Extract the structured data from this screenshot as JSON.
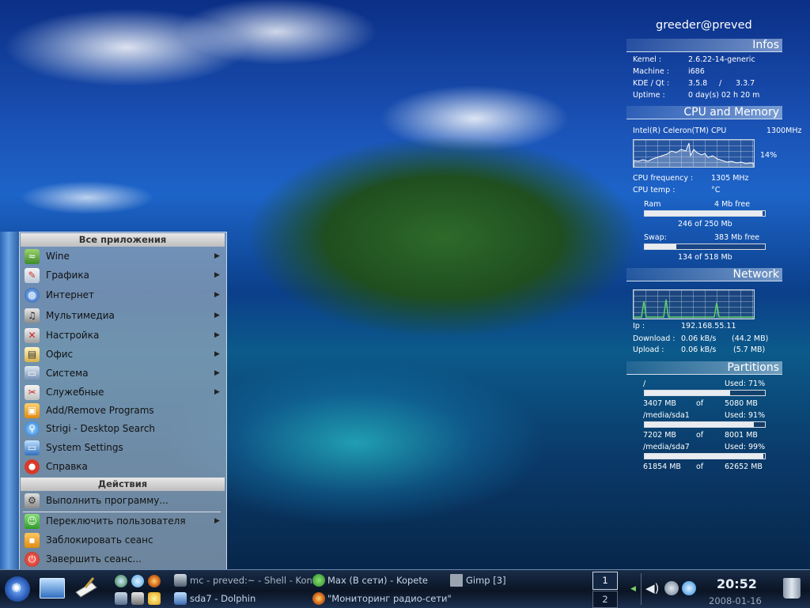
{
  "colors": {
    "accent": "#1d64c8",
    "menu_bg": "#96aabe",
    "taskbar": "#0a1424"
  },
  "menu": {
    "header_all": "Все приложения",
    "header_actions": "Действия",
    "items": [
      {
        "label": "Wine",
        "icon": "wine-icon",
        "arrow": true
      },
      {
        "label": "Графика",
        "icon": "graphics-icon",
        "arrow": true
      },
      {
        "label": "Интернет",
        "icon": "internet-icon",
        "arrow": true
      },
      {
        "label": "Мультимедиа",
        "icon": "multimedia-icon",
        "arrow": true
      },
      {
        "label": "Настройка",
        "icon": "settings-tools-icon",
        "arrow": true
      },
      {
        "label": "Офис",
        "icon": "office-icon",
        "arrow": true
      },
      {
        "label": "Система",
        "icon": "system-icon",
        "arrow": true
      },
      {
        "label": "Служебные",
        "icon": "utilities-icon",
        "arrow": true
      },
      {
        "label": "Add/Remove Programs",
        "icon": "package-icon",
        "arrow": false
      },
      {
        "label": "Strigi - Desktop Search",
        "icon": "search-icon",
        "arrow": false
      },
      {
        "label": "System Settings",
        "icon": "system-settings-icon",
        "arrow": false
      },
      {
        "label": "Справка",
        "icon": "help-icon",
        "arrow": false
      }
    ],
    "actions": [
      {
        "label": "Выполнить программу...",
        "icon": "gear-icon",
        "arrow": false
      },
      {
        "label": "Переключить пользователя",
        "icon": "user-switch-icon",
        "arrow": true
      },
      {
        "label": "Заблокировать сеанс",
        "icon": "lock-icon",
        "arrow": false
      },
      {
        "label": "Завершить сеанс...",
        "icon": "logout-icon",
        "arrow": false
      }
    ],
    "arrow_glyph": "▶"
  },
  "conky": {
    "user": "greeder@preved",
    "infos_title": "Infos",
    "kernel_label": "Kernel :",
    "kernel": "2.6.22-14-generic",
    "machine_label": "Machine :",
    "machine": "i686",
    "kde_label": "KDE / Qt :",
    "kde": "3.5.8",
    "kde_sep": "/",
    "qt": "3.3.7",
    "uptime_label": "Uptime :",
    "uptime": "0 day(s)  02 h 20 m",
    "cpu_title": "CPU and Memory",
    "cpu_name": "Intel(R) Celeron(TM) CPU",
    "cpu_mhz": "1300MHz",
    "cpu_usage": "14%",
    "cpu_freq_label": "CPU frequency :",
    "cpu_freq": "1305 MHz",
    "cpu_temp_label": "CPU temp :",
    "cpu_temp": "°C",
    "ram_label": "Ram",
    "ram_free": "4 Mb free",
    "ram_used": "246 of 250 Mb",
    "ram_frac": 0.98,
    "swap_label": "Swap:",
    "swap_free": "383 Mb free",
    "swap_used": "134 of 518 Mb",
    "swap_frac": 0.26,
    "network_title": "Network",
    "ip_label": "Ip :",
    "ip": "192.168.55.11",
    "down_label": "Download :",
    "down_rate": "0.06 kB/s",
    "down_total": "(44.2 MB)",
    "up_label": "Upload :",
    "up_rate": "0.06 kB/s",
    "up_total": "(5.7 MB)",
    "partitions_title": "Partitions",
    "partitions": [
      {
        "mount": "/",
        "used_label": "Used: 71%",
        "frac": 0.71,
        "used": "3407 MB",
        "of": "of",
        "total": "5080 MB"
      },
      {
        "mount": "/media/sda1",
        "used_label": "Used: 91%",
        "frac": 0.91,
        "used": "7202 MB",
        "of": "of",
        "total": "8001 MB"
      },
      {
        "mount": "/media/sda7",
        "used_label": "Used: 99%",
        "frac": 0.99,
        "used": "61854 MB",
        "of": "of",
        "total": "62652 MB"
      }
    ]
  },
  "taskbar": {
    "tasks": [
      {
        "label": "mc - preved:~ - Shell - Kons",
        "icon": "terminal-icon"
      },
      {
        "label": "Max (В сети) - Kopete",
        "icon": "kopete-icon"
      },
      {
        "label": "Gimp [3]",
        "icon": "gimp-icon"
      },
      {
        "label": "sda7 - Dolphin",
        "icon": "dolphin-icon"
      },
      {
        "label": "\"Мониторинг радио-сети\"",
        "icon": "firefox-icon"
      }
    ],
    "desktops": [
      "1",
      "2"
    ],
    "clock_time": "20:52",
    "clock_date": "2008-01-16"
  }
}
